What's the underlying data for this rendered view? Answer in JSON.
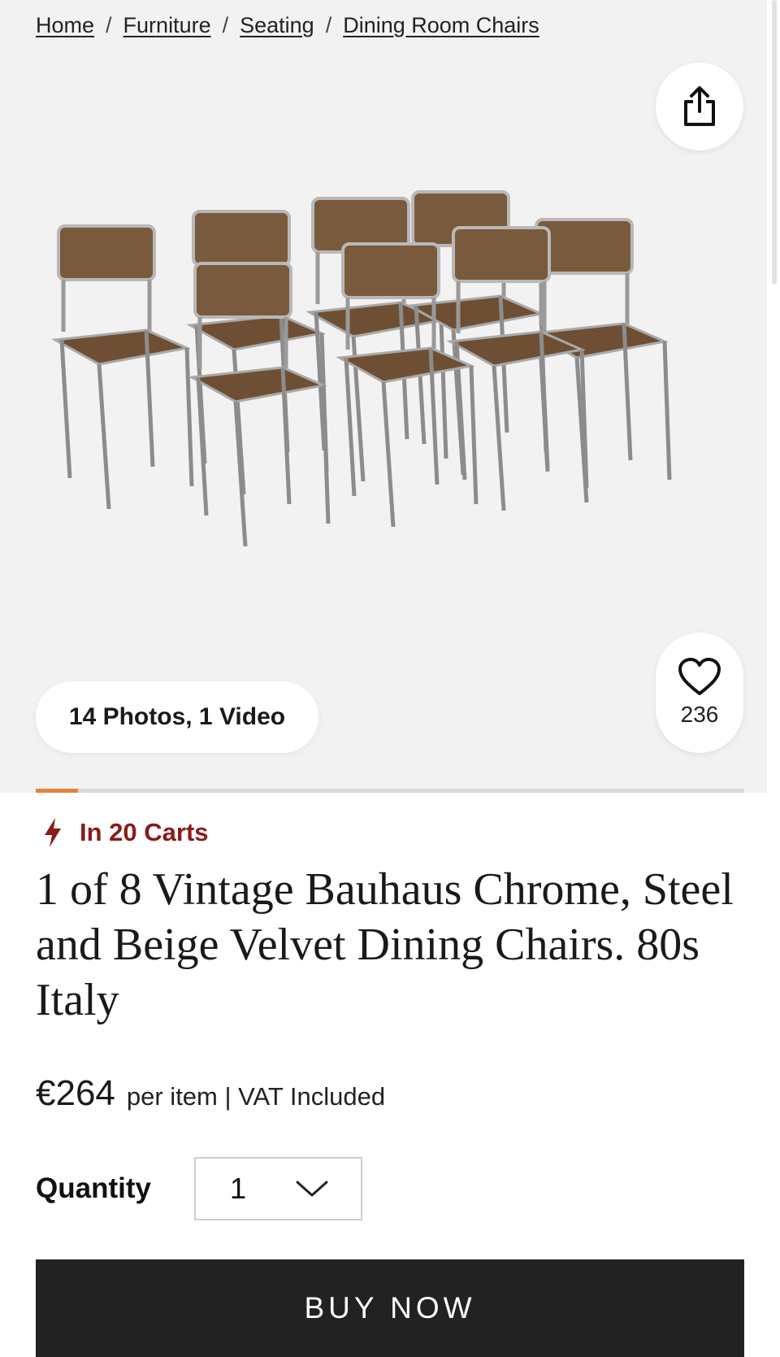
{
  "breadcrumb": {
    "items": [
      {
        "label": "Home"
      },
      {
        "label": "Furniture"
      },
      {
        "label": "Seating"
      },
      {
        "label": "Dining Room Chairs"
      }
    ],
    "separator": "/"
  },
  "gallery": {
    "photos_label": "14 Photos, 1 Video",
    "share_icon": "share-icon",
    "favorite_icon": "heart-icon",
    "favorite_count": "236",
    "progress_fraction": 0.06,
    "progress_color": "#e8823a",
    "image": "product-photo-chairs"
  },
  "product": {
    "carts_icon": "lightning-icon",
    "carts_label": "In 20 Carts",
    "carts_color": "#8b1a1a",
    "title": "1 of 8 Vintage Bauhaus Chrome, Steel and Beige Velvet Dining Chairs. 80s Italy",
    "price": "€264",
    "price_note": "per item | VAT Included"
  },
  "quantity": {
    "label": "Quantity",
    "value": "1",
    "chevron_icon": "chevron-down-icon"
  },
  "actions": {
    "buy_now": "BUY NOW",
    "buy_bg": "#222222"
  }
}
